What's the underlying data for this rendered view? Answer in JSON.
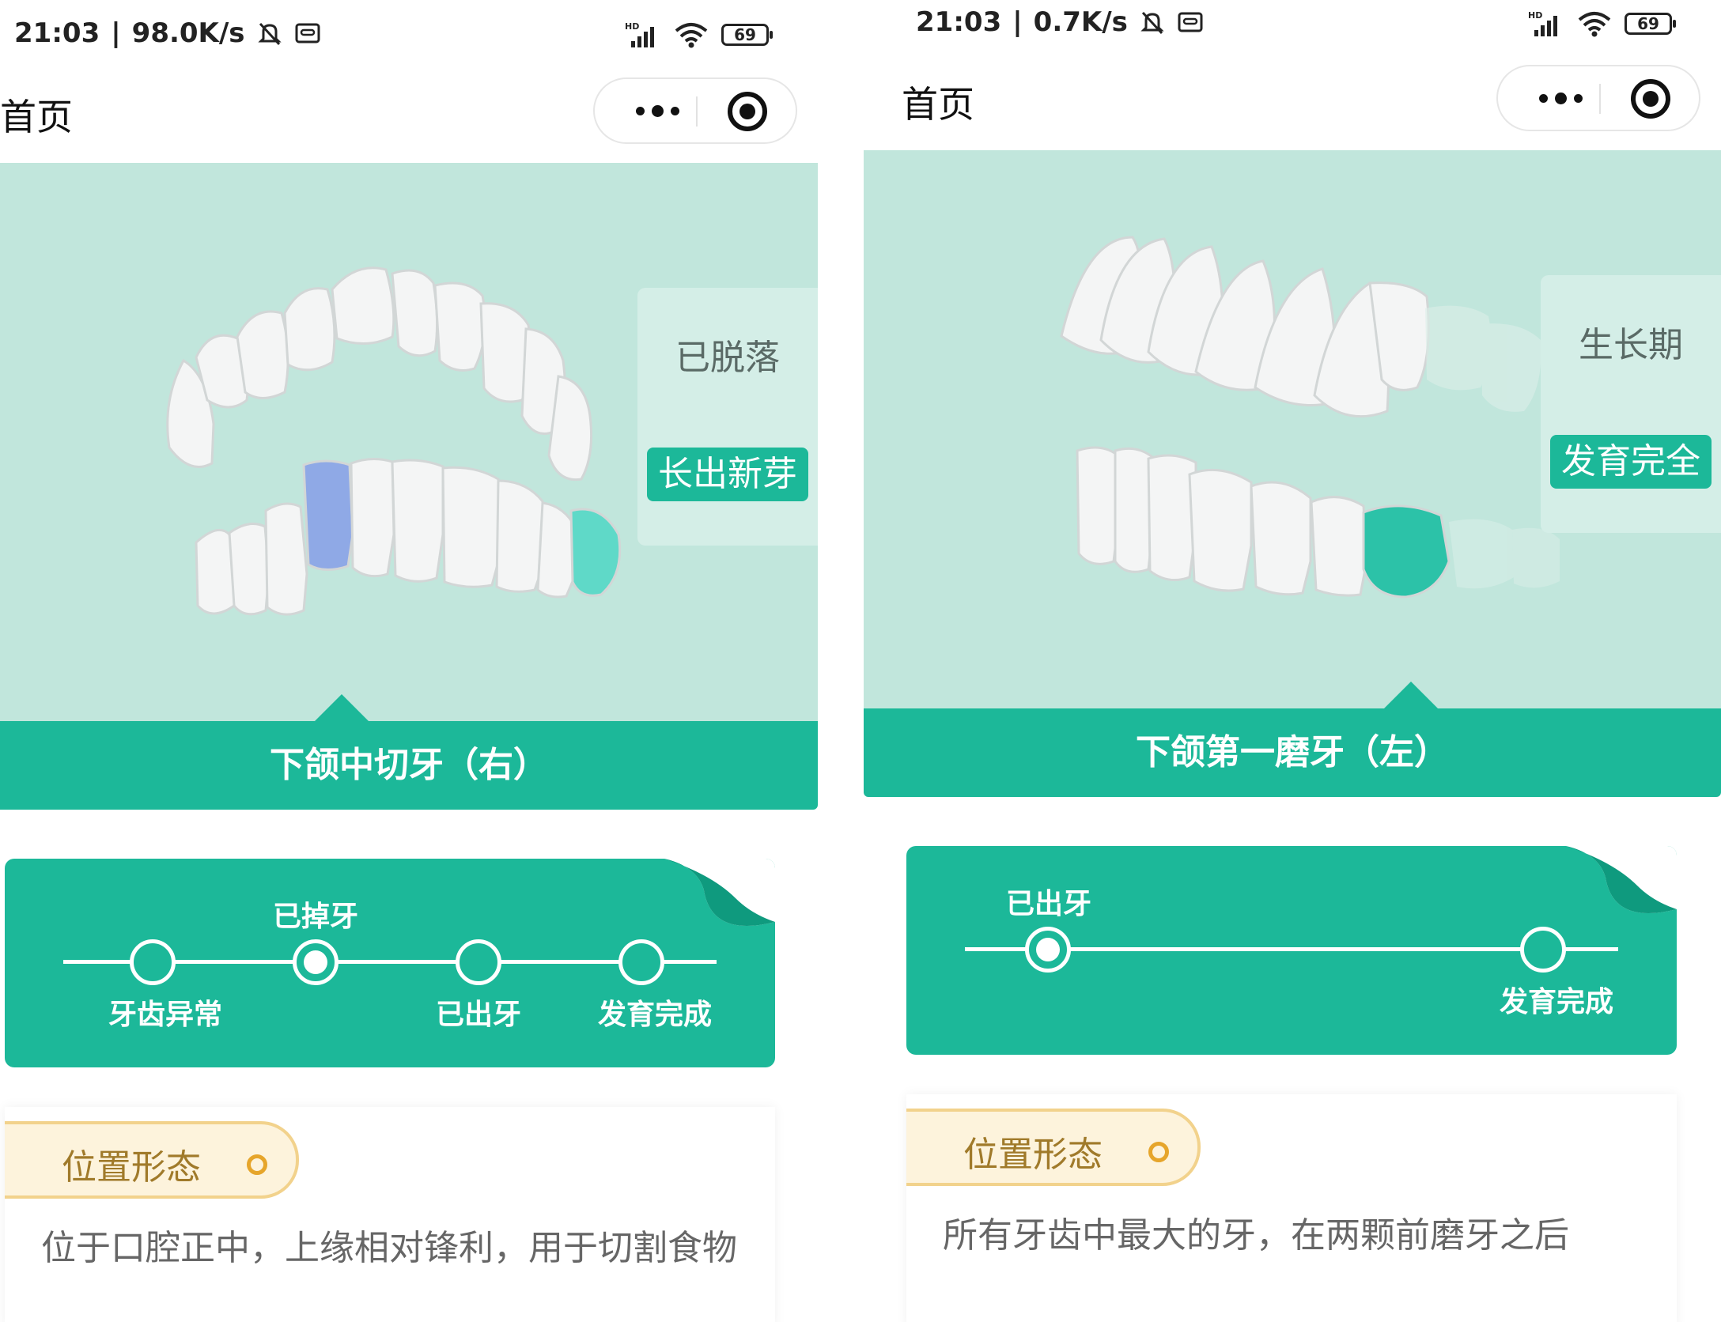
{
  "screens": [
    {
      "status": {
        "time": "21:03",
        "speed": "98.0K/s",
        "signal": "HD",
        "battery": "69"
      },
      "header": {
        "title": "首页"
      },
      "state_card": {
        "text": "已脱落",
        "badge": "长出新芽"
      },
      "tooth_name": "下颌中切牙（右）",
      "timeline": {
        "top_label": "已掉牙",
        "labels": [
          "牙齿异常",
          "已出牙",
          "发育完成"
        ],
        "active_step": 2,
        "highlight_color": "#8fa9e6"
      },
      "info": {
        "tag": "位置形态",
        "description": "位于口腔正中，上缘相对锋利，用于切割食物"
      }
    },
    {
      "status": {
        "time": "21:03",
        "speed": "0.7K/s",
        "signal": "HD",
        "battery": "69"
      },
      "header": {
        "title": "首页"
      },
      "state_card": {
        "text": "生长期",
        "badge": "发育完全"
      },
      "tooth_name": "下颌第一磨牙（左）",
      "timeline": {
        "top_label": "已出牙",
        "labels": [
          "发育完成"
        ],
        "active_step": 1,
        "highlight_color": "#2cc2a8"
      },
      "info": {
        "tag": "位置形态",
        "description": "所有牙齿中最大的牙，在两颗前磨牙之后"
      }
    }
  ],
  "colors": {
    "primary": "#1cb899",
    "viewer_bg": "#c1e6dc",
    "tag_bg": "#fdf3dc",
    "tag_border": "#f2d28c",
    "tag_text": "#a07a2a"
  },
  "icons": [
    "mute-bell-icon",
    "screen-record-icon",
    "signal-icon",
    "wifi-icon",
    "battery-icon",
    "more-dots-icon",
    "target-circle-icon"
  ]
}
